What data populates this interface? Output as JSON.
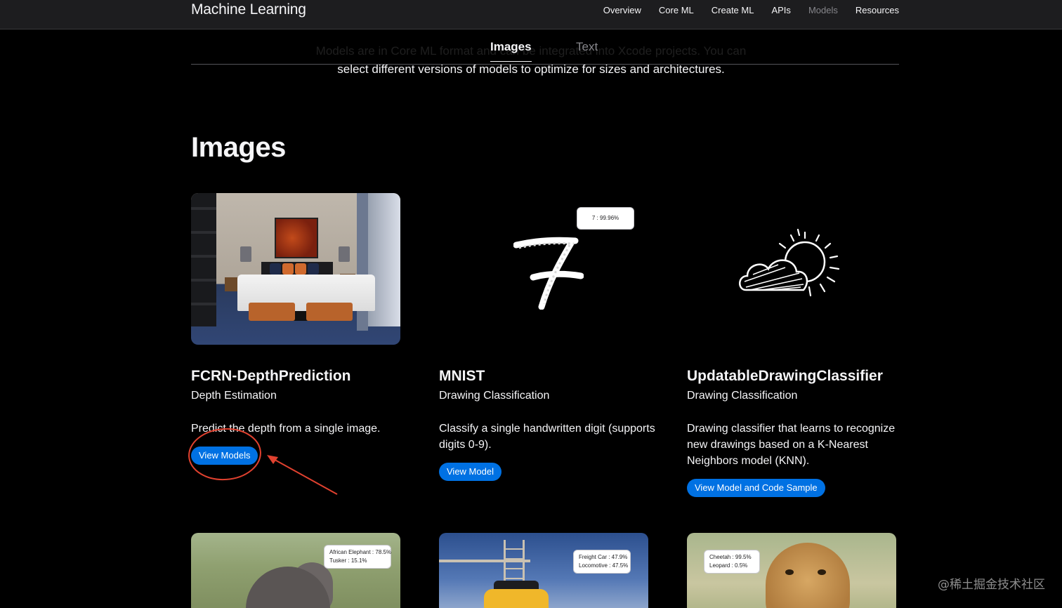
{
  "brand": "Machine Learning",
  "nav": {
    "items": [
      "Overview",
      "Core ML",
      "Create ML",
      "APIs",
      "Models",
      "Resources"
    ],
    "current": "Models"
  },
  "subtabs": {
    "images": "Images",
    "text": "Text"
  },
  "intro": {
    "line1": "Models are in Core ML format and can be integrated into Xcode projects. You can",
    "line2": "select different versions of models to optimize for sizes and architectures."
  },
  "section_title": "Images",
  "cards": [
    {
      "name": "FCRN-DepthPrediction",
      "category": "Depth Estimation",
      "description": "Predict the depth from a single image.",
      "button": "View Models"
    },
    {
      "name": "MNIST",
      "category": "Drawing Classification",
      "description": "Classify a single handwritten digit (supports digits 0-9).",
      "button": "View Model",
      "prediction": "7 : 99.96%"
    },
    {
      "name": "UpdatableDrawingClassifier",
      "category": "Drawing Classification",
      "description": "Drawing classifier that learns to recognize new drawings based on a K-Nearest Neighbors model (KNN).",
      "button": "View Model and Code Sample"
    }
  ],
  "bottom_cards": [
    {
      "pred1": "African Elephant : 78.5%",
      "pred2": "Tusker : 15.1%"
    },
    {
      "pred1": "Freight Car : 47.9%",
      "pred2": "Locomotive : 47.5%"
    },
    {
      "pred1": "Cheetah : 99.5%",
      "pred2": "Leopard : 0.5%"
    }
  ],
  "watermark": "@稀土掘金技术社区",
  "colors": {
    "accent": "#0071e3",
    "annotation": "#e0412f",
    "nav_bg": "#1d1d1f"
  }
}
